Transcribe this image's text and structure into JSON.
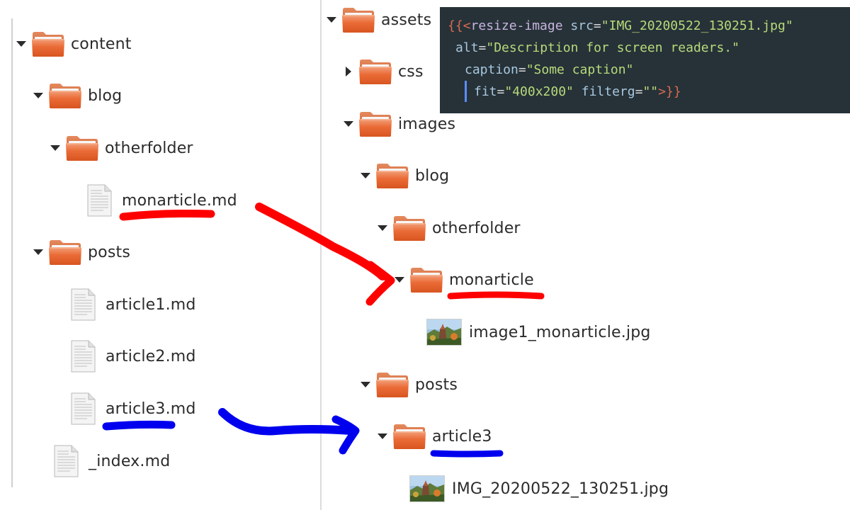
{
  "left_tree": {
    "content": "content",
    "blog": "blog",
    "otherfolder": "otherfolder",
    "monarticle_md": "monarticle.md",
    "posts": "posts",
    "article1_md": "article1.md",
    "article2_md": "article2.md",
    "article3_md": "article3.md",
    "index_md": "_index.md"
  },
  "right_tree": {
    "assets": "assets",
    "css": "css",
    "images": "images",
    "blog": "blog",
    "otherfolder": "otherfolder",
    "monarticle": "monarticle",
    "image1_monarticle": "image1_monarticle.jpg",
    "posts": "posts",
    "article3": "article3",
    "img_file": "IMG_20200522_130251.jpg"
  },
  "code": {
    "open_braces": "{{<",
    "shortcode_name": "resize-image",
    "src_attr": "src",
    "src_value": "\"IMG_20200522_130251.jpg\"",
    "alt_attr": "alt",
    "alt_value": "\"Description for screen readers.\"",
    "caption_attr": "caption",
    "caption_value": "\"Some caption\"",
    "fit_attr": "fit",
    "fit_value": "\"400x200\"",
    "filter_attr": "filterg",
    "filter_value": "\"\"",
    "close_braces": ">}}",
    "equals": "="
  },
  "colors": {
    "folder_orange": "#e8622a",
    "code_background": "#263238",
    "red_annotation": "#ff0000",
    "blue_annotation": "#0000ee"
  },
  "icons": {
    "folder": "folder-icon",
    "file": "text-file-icon",
    "image": "image-file-icon",
    "expand": "triangle-down-icon",
    "collapse": "triangle-right-icon"
  }
}
